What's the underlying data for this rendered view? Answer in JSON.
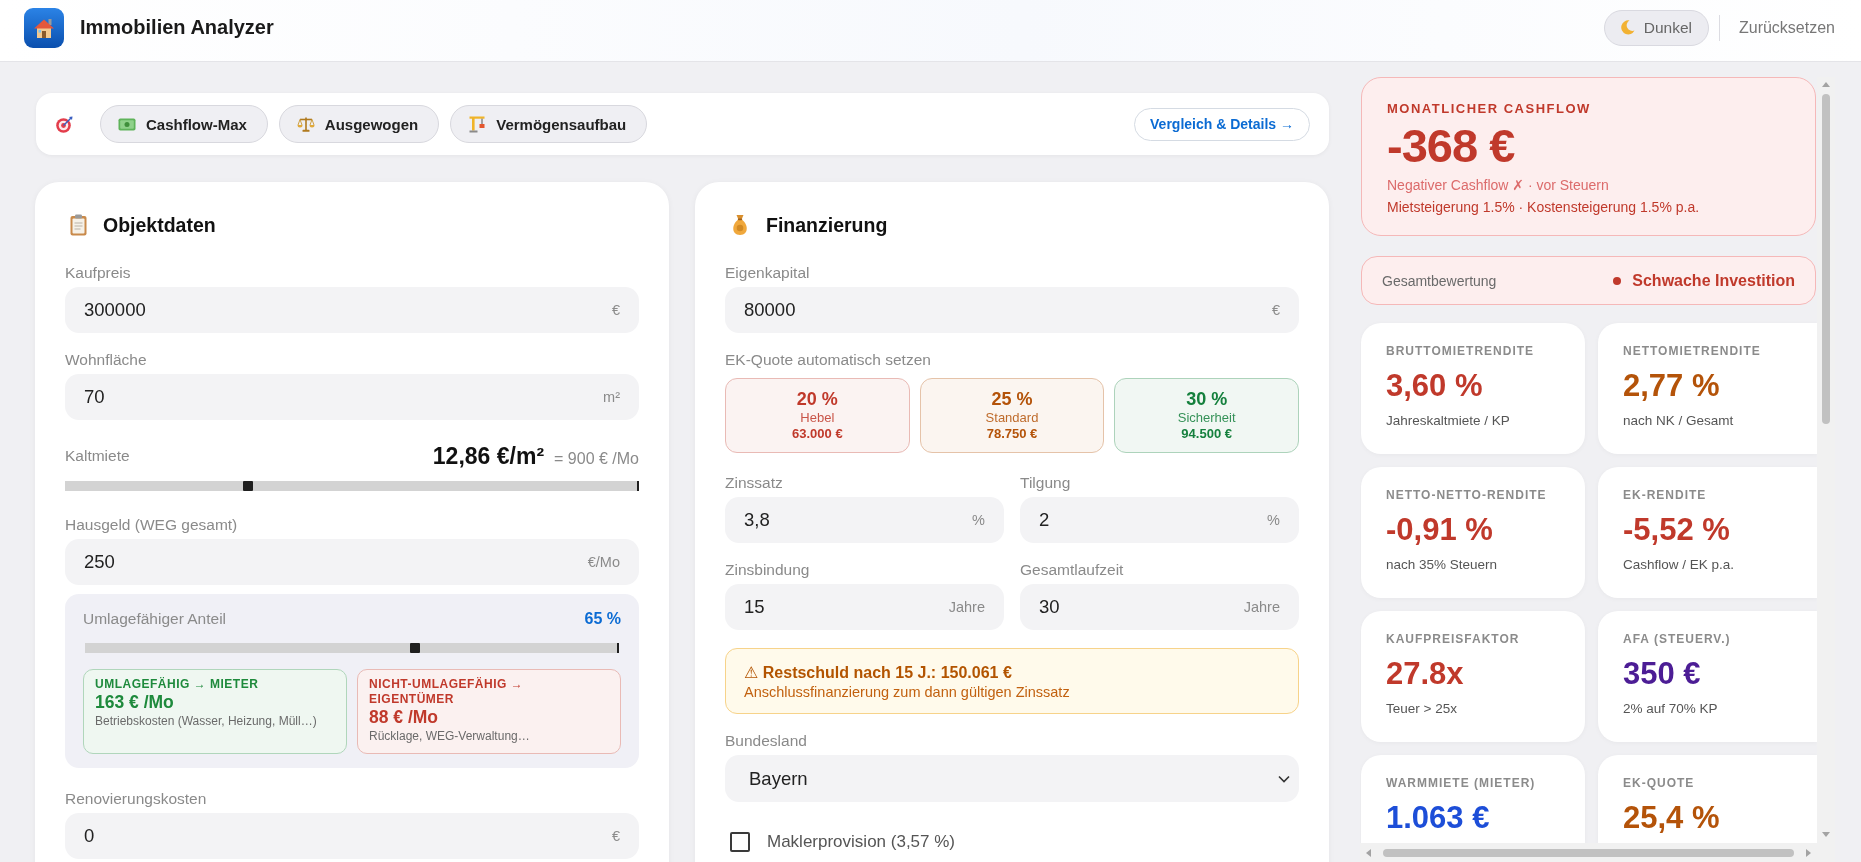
{
  "app": {
    "title": "Immobilien Analyzer"
  },
  "header_actions": [
    {
      "kind": "theme",
      "label": "Dunkel"
    },
    {
      "kind": "reset",
      "label": "Zurücksetzen"
    }
  ],
  "strategy_bar": {
    "presets": [
      {
        "kind": "cashflow",
        "label": "Cashflow-Max"
      },
      {
        "kind": "balanced",
        "label": "Ausgewogen"
      },
      {
        "kind": "growth",
        "label": "Vermögensaufbau"
      }
    ],
    "details_button": "Vergleich & Details →"
  },
  "object_panel": {
    "title": "Objektdaten",
    "fields": [
      {
        "kind": "input",
        "label": "Kaufpreis",
        "value": "300000",
        "unit": "€"
      },
      {
        "kind": "input",
        "label": "Wohnfläche",
        "value": "70",
        "unit": "m²"
      },
      {
        "kind": "slider",
        "label": "Kaltmiete",
        "reading": "12,86 €/m²",
        "note": "= 900 € /Mo",
        "level": 0.32
      },
      {
        "kind": "input",
        "label": "Hausgeld (WEG gesamt)",
        "value": "250",
        "unit": "€/Mo",
        "allocation": {
          "label": "Umlagefähiger Anteil",
          "reading": "65 %",
          "level": 0.62,
          "parts": [
            {
              "title": "UMLAGEFÄHIG → MIETER",
              "amount": "163 € /Mo",
              "note": "Betriebskosten (Wasser, Heizung, Müll…)",
              "color": "#1e8a3c"
            },
            {
              "title": "NICHT-UMLAGEFÄHIG → EIGENTÜMER",
              "amount": "88 € /Mo",
              "note": "Rücklage, WEG-Verwaltung…",
              "color": "#c0392b"
            }
          ]
        }
      },
      {
        "kind": "input",
        "label": "Renovierungskosten",
        "value": "0",
        "unit": "€"
      }
    ]
  },
  "financing_panel": {
    "title": "Finanzierung",
    "fields": [
      {
        "kind": "input",
        "label": "Eigenkapital",
        "value": "80000",
        "unit": "€"
      },
      {
        "kind": "presets",
        "label": "EK-Quote automatisch setzen",
        "options": [
          {
            "percent": "20 %",
            "name": "Hebel",
            "amount": "63.000 €",
            "color": "#c0392b"
          },
          {
            "percent": "25 %",
            "name": "Standard",
            "amount": "78.750 €",
            "color": "#b45309"
          },
          {
            "percent": "30 %",
            "name": "Sicherheit",
            "amount": "94.500 €",
            "color": "#15803d"
          }
        ]
      },
      {
        "kind": "pair",
        "items": [
          {
            "label": "Zinssatz",
            "value": "3,8",
            "unit": "%"
          },
          {
            "label": "Tilgung",
            "value": "2",
            "unit": "%"
          }
        ]
      },
      {
        "kind": "pair",
        "items": [
          {
            "label": "Zinsbindung",
            "value": "15",
            "unit": "Jahre"
          },
          {
            "label": "Gesamtlaufzeit",
            "value": "30",
            "unit": "Jahre"
          }
        ]
      },
      {
        "kind": "notice",
        "title": "⚠ Restschuld nach 15 J.: 150.061 €",
        "text": "Anschlussfinanzierung zum dann gültigen Zinssatz"
      },
      {
        "kind": "select",
        "label": "Bundesland",
        "value": "Bayern"
      },
      {
        "kind": "checkbox",
        "label": "Maklerprovision (3,57 %)",
        "checked": false
      }
    ]
  },
  "cashflow": {
    "label": "MONATLICHER CASHFLOW",
    "value": "-368 €",
    "status": "Negativer Cashflow ✗ · vor Steuern",
    "assumptions": "Mietsteigerung 1.5% · Kostensteigerung 1.5% p.a.",
    "negative": true
  },
  "rating": {
    "label": "Gesamtbewertung",
    "value": "Schwache Investition",
    "negative": true
  },
  "metrics": [
    {
      "label": "BRUTTOMIETRENDITE",
      "value": "3,60 %",
      "note": "Jahreskaltmiete / KP",
      "color": "#c0392b"
    },
    {
      "label": "NETTOMIETRENDITE",
      "value": "2,77 %",
      "note": "nach NK / Gesamt",
      "color": "#b45309"
    },
    {
      "label": "NETTO-NETTO-RENDITE",
      "value": "-0,91 %",
      "note": "nach 35% Steuern",
      "color": "#c0392b"
    },
    {
      "label": "EK-RENDITE",
      "value": "-5,52 %",
      "note": "Cashflow / EK p.a.",
      "color": "#c0392b"
    },
    {
      "label": "KAUFPREISFAKTOR",
      "value": "27.8x",
      "note": "Teuer > 25x",
      "color": "#c0392b"
    },
    {
      "label": "AFA (STEUERV.)",
      "value": "350 €",
      "note": "2% auf 70% KP",
      "color": "#4c1d95"
    },
    {
      "label": "WARMMIETE (MIETER)",
      "value": "1.063 €",
      "color": "#1d4ed8"
    },
    {
      "label": "EK-QUOTE",
      "value": "25,4 %",
      "color": "#b45309"
    }
  ]
}
